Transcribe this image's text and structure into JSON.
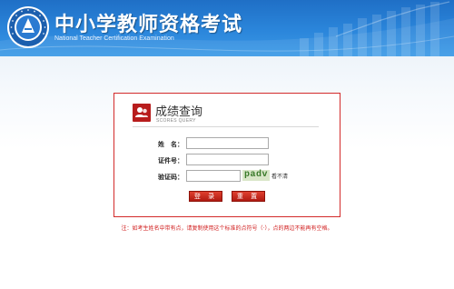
{
  "header": {
    "title_cn": "中小学教师资格考试",
    "title_en": "National Teacher Certification Examination",
    "logo_icon": "exam-emblem-icon"
  },
  "panel": {
    "title": "成绩查询",
    "subtitle": "SCORES QUERY",
    "icon": "users-icon"
  },
  "form": {
    "name_label": "姓　名：",
    "name_value": "",
    "id_label": "证件号：",
    "id_value": "",
    "captcha_label": "验证码：",
    "captcha_value": "",
    "captcha_text": "padv",
    "refresh_text": "看不清"
  },
  "buttons": {
    "login": "登 录",
    "reset": "重 置"
  },
  "note": "注：如考生姓名中带有点，请复制使用这个标准的点符号（·），点的两边不能再有空格。",
  "colors": {
    "banner": "#2b86db",
    "accent_red": "#c8211a",
    "note_red": "#d01c1c"
  }
}
